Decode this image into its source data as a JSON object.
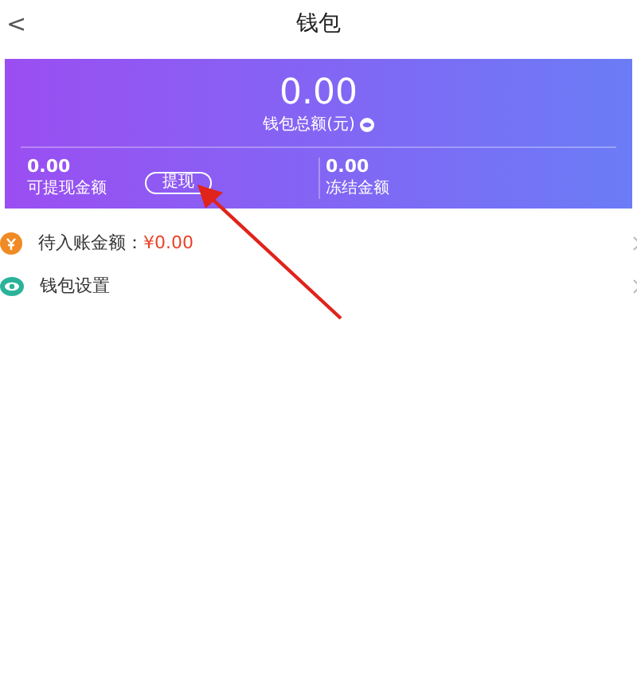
{
  "header": {
    "back": "<",
    "title": "钱包"
  },
  "balance": {
    "amount": "0.00",
    "label": "钱包总额(元)"
  },
  "stats": [
    {
      "amount": "0.00",
      "label": "可提现金额",
      "action": "提现"
    },
    {
      "amount": "0.00",
      "label": "冻结金额"
    }
  ],
  "rows": [
    {
      "kind": "pending",
      "label": "待入账金额：",
      "value": "¥0.00"
    },
    {
      "kind": "settings",
      "label": "钱包设置"
    }
  ]
}
